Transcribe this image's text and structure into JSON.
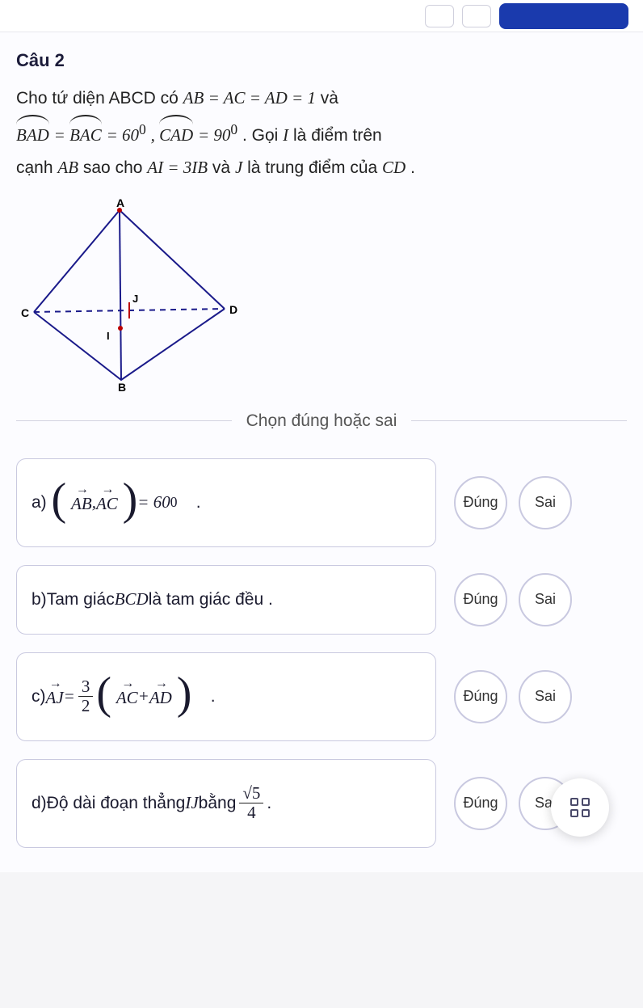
{
  "question": {
    "label": "Câu 2",
    "prompt_line1_pre": "Cho tứ diện ABCD có ",
    "prompt_eq1": "AB = AC = AD = 1",
    "prompt_line1_post": " và",
    "prompt_ang1": "BAD",
    "prompt_ang2": "BAC",
    "prompt_ang_eq_a": " = ",
    "prompt_ang_val1": "60",
    "prompt_ang_deg1": "0",
    "prompt_sep": " , ",
    "prompt_ang3": "CAD",
    "prompt_ang_val2": "90",
    "prompt_ang_deg2": "0",
    "prompt_line2_post": ". Gọi ",
    "prompt_I": "I",
    "prompt_line2_post2": " là điểm trên",
    "prompt_line3_pre": "cạnh ",
    "prompt_AB": "AB",
    "prompt_line3_mid": " sao cho ",
    "prompt_eq2": "AI = 3IB",
    "prompt_line3_mid2": " và ",
    "prompt_J": "J",
    "prompt_line3_mid3": " là trung điểm của ",
    "prompt_CD": "CD",
    "prompt_line3_end": "."
  },
  "figure": {
    "labels": {
      "A": "A",
      "B": "B",
      "C": "C",
      "D": "D",
      "I": "I",
      "J": "J"
    }
  },
  "instruction": "Chọn đúng hoặc sai",
  "answers": {
    "a": {
      "prefix": "a)",
      "vec1": "AB",
      "sep": " , ",
      "vec2": "AC",
      "eq": " = 60",
      "deg": "0",
      "dot": "."
    },
    "b": {
      "prefix": "b) ",
      "text1": "Tam giác ",
      "bcd": "BCD",
      "text2": " là tam giác đều ."
    },
    "c": {
      "prefix": "c) ",
      "aj": "AJ",
      "eq": " = ",
      "frac_n": "3",
      "frac_d": "2",
      "vec1": "AC",
      "plus": " + ",
      "vec2": "AD",
      "dot": "."
    },
    "d": {
      "prefix": "d) ",
      "text1": "Độ dài đoạn thẳng ",
      "ij": "IJ",
      "text2": " bằng ",
      "frac_n": "√5",
      "frac_d": "4",
      "dot": "."
    }
  },
  "buttons": {
    "true": "Đúng",
    "false": "Sai"
  }
}
